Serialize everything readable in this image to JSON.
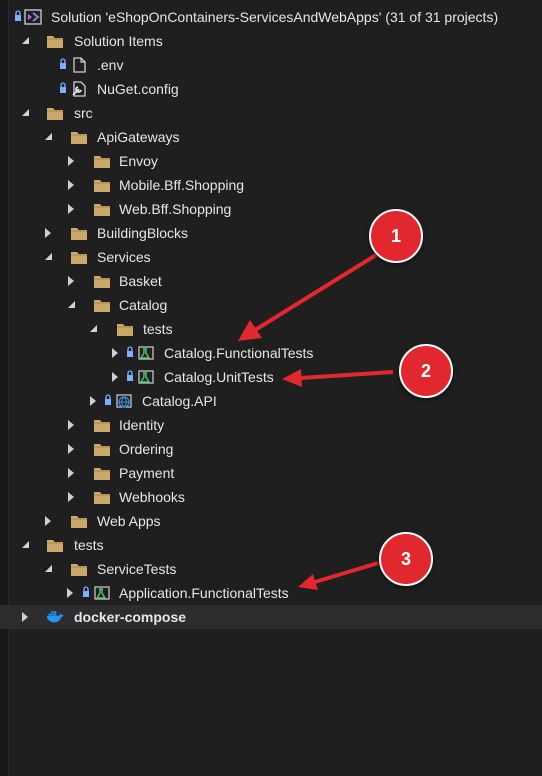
{
  "solution": {
    "title": "Solution 'eShopOnContainers-ServicesAndWebApps' (31 of 31 projects)"
  },
  "tree": {
    "solution_items": "Solution Items",
    "env": ".env",
    "nuget": "NuGet.config",
    "src": "src",
    "api_gateways": "ApiGateways",
    "envoy": "Envoy",
    "mobile_bff": "Mobile.Bff.Shopping",
    "web_bff": "Web.Bff.Shopping",
    "building_blocks": "BuildingBlocks",
    "services": "Services",
    "basket": "Basket",
    "catalog": "Catalog",
    "tests_folder": "tests",
    "catalog_functional": "Catalog.FunctionalTests",
    "catalog_unit": "Catalog.UnitTests",
    "catalog_api": "Catalog.API",
    "identity": "Identity",
    "ordering": "Ordering",
    "payment": "Payment",
    "webhooks": "Webhooks",
    "web_apps": "Web Apps",
    "tests_root": "tests",
    "service_tests": "ServiceTests",
    "application_functional": "Application.FunctionalTests",
    "docker_compose": "docker-compose"
  },
  "callouts": {
    "one": "1",
    "two": "2",
    "three": "3"
  },
  "colors": {
    "background": "#1f1f1f",
    "folder": "#c9a86a",
    "callout": "#e0282e",
    "docker": "#2496ed",
    "vs_purple": "#a276d6"
  },
  "icons": {
    "folder": "folder-icon",
    "file": "file-icon",
    "config": "config-icon",
    "test_project": "test-project-icon",
    "web_project": "web-project-icon",
    "docker": "docker-icon",
    "solution": "visual-studio-icon",
    "lock": "lock-icon"
  }
}
